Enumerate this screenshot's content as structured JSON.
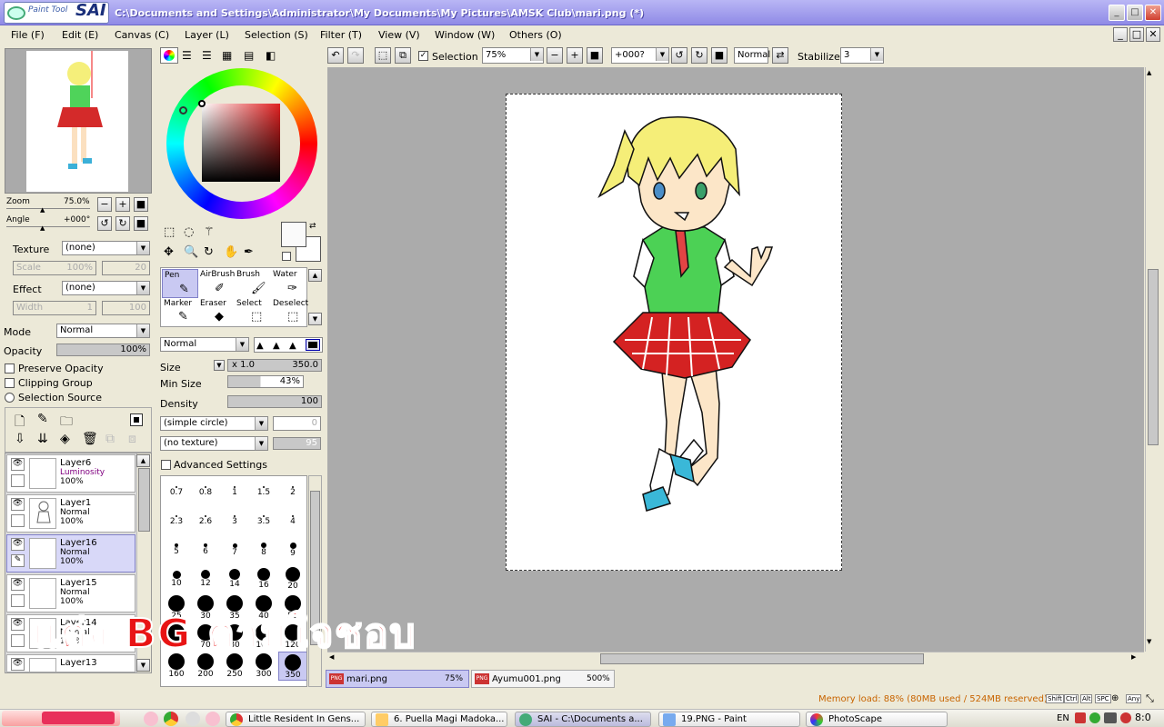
{
  "app": {
    "logo_small": "Paint Tool",
    "logo_big": "SAI",
    "title": "C:\\Documents and Settings\\Administrator\\My Documents\\My Pictures\\AMSK Club\\mari.png (*)"
  },
  "menu": [
    "File (F)",
    "Edit (E)",
    "Canvas (C)",
    "Layer (L)",
    "Selection (S)",
    "Filter (T)",
    "View (V)",
    "Window (W)",
    "Others (O)"
  ],
  "navigator": {
    "zoom_label": "Zoom",
    "zoom_value": "75.0%",
    "angle_label": "Angle",
    "angle_value": "+000°"
  },
  "texture": {
    "label": "Texture",
    "value": "(none)",
    "scale_label": "Scale",
    "scale_value": "100%",
    "scale_num": "20"
  },
  "effect": {
    "label": "Effect",
    "value": "(none)",
    "width_label": "Width",
    "width_value": "1",
    "width_num": "100"
  },
  "layer_props": {
    "mode_label": "Mode",
    "mode_value": "Normal",
    "opacity_label": "Opacity",
    "opacity_value": "100%",
    "preserve_opacity": "Preserve Opacity",
    "clipping_group": "Clipping Group",
    "selection_source": "Selection Source"
  },
  "layers": [
    {
      "name": "Layer6",
      "mode": "Luminosity",
      "opacity": "100%"
    },
    {
      "name": "Layer1",
      "mode": "Normal",
      "opacity": "100%"
    },
    {
      "name": "Layer16",
      "mode": "Normal",
      "opacity": "100%"
    },
    {
      "name": "Layer15",
      "mode": "Normal",
      "opacity": "100%"
    },
    {
      "name": "Layer14",
      "mode": "Normal",
      "opacity": "100%"
    },
    {
      "name": "Layer13",
      "mode": "Normal",
      "opacity": "100%"
    }
  ],
  "tools": [
    {
      "label": "Pen"
    },
    {
      "label": "AirBrush"
    },
    {
      "label": "Brush"
    },
    {
      "label": "Water"
    },
    {
      "label": "Marker"
    },
    {
      "label": "Eraser"
    },
    {
      "label": "Select"
    },
    {
      "label": "Deselect"
    }
  ],
  "brush": {
    "blend": "Normal",
    "size_label": "Size",
    "size_mult": "x 1.0",
    "size_value": "350.0",
    "minsize_label": "Min Size",
    "minsize_value": "43%",
    "density_label": "Density",
    "density_value": "100",
    "shape": "(simple circle)",
    "shape_num": "0",
    "texture": "(no texture)",
    "texture_num": "95",
    "advanced": "Advanced Settings"
  },
  "brush_sizes": [
    "0.7",
    "0.8",
    "1",
    "1.5",
    "2",
    "2.3",
    "2.6",
    "3",
    "3.5",
    "4",
    "5",
    "6",
    "7",
    "8",
    "9",
    "10",
    "12",
    "14",
    "16",
    "20",
    "25",
    "30",
    "35",
    "40",
    "50",
    "60",
    "70",
    "80",
    "100",
    "120",
    "160",
    "200",
    "250",
    "300",
    "350"
  ],
  "toolbar": {
    "selection_label": "Selection",
    "zoom": "75%",
    "angle": "+000?",
    "mode": "Normal",
    "stabilizer_label": "Stabilizer",
    "stabilizer_value": "3"
  },
  "overlay_text": "แต่ง BG ตามใจชอบ",
  "doc_tabs": [
    {
      "name": "mari.png",
      "zoom": "75%"
    },
    {
      "name": "Ayumu001.png",
      "zoom": "500%"
    }
  ],
  "status": {
    "memory": "Memory load: 88% (80MB used / 524MB reserved)",
    "keys": [
      "Shift",
      "Ctrl",
      "Alt",
      "SPC",
      "Any"
    ]
  },
  "taskbar": {
    "items": [
      "Little Resident In Gens...",
      "6. Puella Magi Madoka...",
      "SAI - C:\\Documents a...",
      "19.PNG - Paint",
      "PhotoScape"
    ],
    "lang": "EN",
    "clock": "8:0"
  },
  "colors": {
    "title_bar": "#9b97ee",
    "accent": "#8080c8",
    "overlay_text": "#e81414",
    "memory_text": "#c86400"
  }
}
